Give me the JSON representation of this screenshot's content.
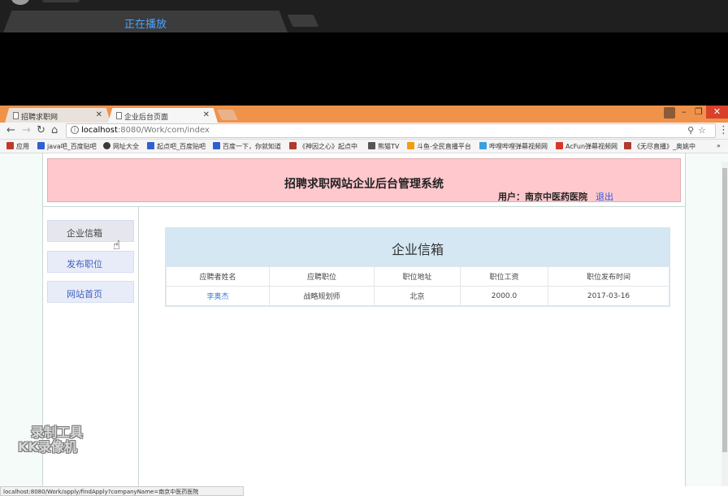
{
  "player": {
    "status": "正在播放"
  },
  "browser": {
    "tabs": [
      {
        "label": "招聘求职网"
      },
      {
        "label": "企业后台页面"
      }
    ],
    "url_host": "localhost",
    "url_path": ":8080/Work/com/index",
    "bookmarks": [
      {
        "label": "应用",
        "icon": "apps-grid-icon",
        "color": "#c0392b"
      },
      {
        "label": "java吧_百度贴吧",
        "icon": "baidu-paw-icon",
        "color": "#2f5fd0"
      },
      {
        "label": "网址大全",
        "icon": "site-icon",
        "color": "#3a3a3a"
      },
      {
        "label": "起点吧_百度贴吧",
        "icon": "baidu-paw-icon",
        "color": "#2f5fd0"
      },
      {
        "label": "百度一下，你就知道",
        "icon": "baidu-paw-icon",
        "color": "#2f5fd0"
      },
      {
        "label": "《神因之心》起点中",
        "icon": "qidian-icon",
        "color": "#b03a2e"
      },
      {
        "label": "熊猫TV",
        "icon": "panda-icon",
        "color": "#555555"
      },
      {
        "label": "斗鱼-全民直播平台",
        "icon": "douyu-icon",
        "color": "#f39c12"
      },
      {
        "label": "哔哩哔哩弹幕视频网",
        "icon": "bilibili-icon",
        "color": "#3aa0e0"
      },
      {
        "label": "AcFun弹幕视频网",
        "icon": "acfun-icon",
        "color": "#d9362b"
      },
      {
        "label": "《无尽直播》_奥姚中",
        "icon": "book-icon",
        "color": "#b03a2e"
      }
    ],
    "status_url": "localhost:8080/Work/apply/findApply?companyName=南京中医药医院"
  },
  "page": {
    "header_title": "招聘求职网站企业后台管理系统",
    "user_label": "用户：南京中医药医院",
    "logout": "退出",
    "nav": [
      {
        "label": "企业信箱"
      },
      {
        "label": "发布职位"
      },
      {
        "label": "网站首页"
      }
    ],
    "mailbox": {
      "title": "企业信箱",
      "columns": [
        "应聘者姓名",
        "应聘职位",
        "职位地址",
        "职位工资",
        "职位发布时间"
      ],
      "rows": [
        [
          "李奥杰",
          "战略规划师",
          "北京",
          "2000.0",
          "2017-03-16"
        ]
      ]
    }
  },
  "watermark": {
    "line1": "录制工具",
    "line2": "KK录像机"
  }
}
